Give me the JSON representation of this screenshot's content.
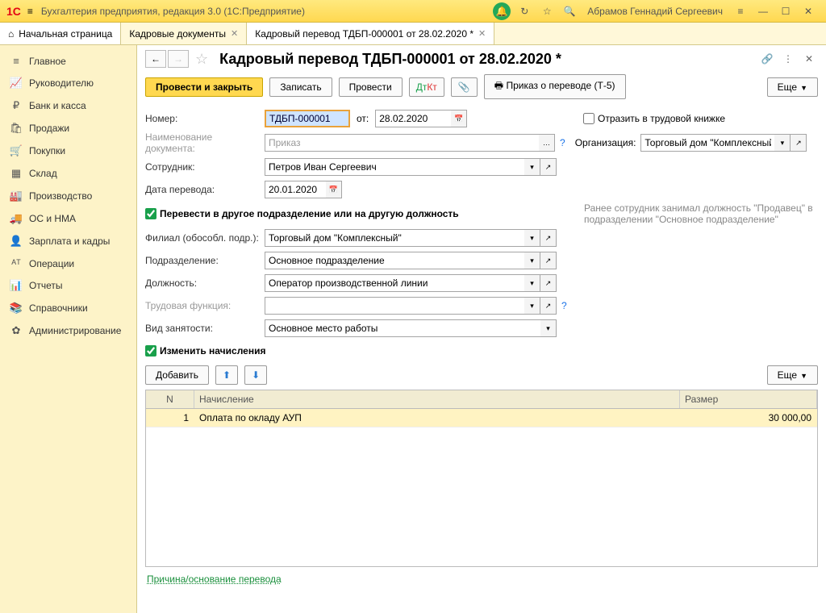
{
  "titlebar": {
    "app_title": "Бухгалтерия предприятия, редакция 3.0  (1С:Предприятие)",
    "user": "Абрамов Геннадий Сергеевич"
  },
  "tabs": {
    "home": "Начальная страница",
    "t1": "Кадровые документы",
    "t2": "Кадровый перевод ТДБП-000001 от 28.02.2020 *"
  },
  "sidebar": [
    {
      "icon": "≡",
      "label": "Главное"
    },
    {
      "icon": "📈",
      "label": "Руководителю"
    },
    {
      "icon": "₽",
      "label": "Банк и касса"
    },
    {
      "icon": "🛍",
      "label": "Продажи"
    },
    {
      "icon": "🛒",
      "label": "Покупки"
    },
    {
      "icon": "▦",
      "label": "Склад"
    },
    {
      "icon": "🏭",
      "label": "Производство"
    },
    {
      "icon": "🚚",
      "label": "ОС и НМА"
    },
    {
      "icon": "👤",
      "label": "Зарплата и кадры"
    },
    {
      "icon": "ᴬᵀ",
      "label": "Операции"
    },
    {
      "icon": "📊",
      "label": "Отчеты"
    },
    {
      "icon": "📚",
      "label": "Справочники"
    },
    {
      "icon": "✿",
      "label": "Администрирование"
    }
  ],
  "doc": {
    "title": "Кадровый перевод ТДБП-000001 от 28.02.2020 *",
    "cmds": {
      "post_close": "Провести и закрыть",
      "save": "Записать",
      "post": "Провести",
      "order": "Приказ о переводе (Т-5)",
      "more": "Еще"
    },
    "labels": {
      "number": "Номер:",
      "from": "от:",
      "reflect": "Отразить в трудовой книжке",
      "docname": "Наименование документа:",
      "org": "Организация:",
      "employee": "Сотрудник:",
      "transfer_date": "Дата перевода:",
      "do_transfer": "Перевести в другое подразделение или на другую должность",
      "branch": "Филиал (обособл. подр.):",
      "dept": "Подразделение:",
      "position": "Должность:",
      "labor_func": "Трудовая функция:",
      "emp_type": "Вид занятости:",
      "do_change": "Изменить начисления",
      "add": "Добавить",
      "prev_note": "Ранее сотрудник занимал должность \"Продавец\" в подразделении \"Основное подразделение\"",
      "footer": "Причина/основание перевода"
    },
    "values": {
      "number": "ТДБП-000001",
      "date": "28.02.2020",
      "docname": "Приказ",
      "org": "Торговый дом \"Комплексный\"",
      "employee": "Петров Иван Сергеевич",
      "transfer_date": "20.01.2020",
      "branch": "Торговый дом \"Комплексный\"",
      "dept": "Основное подразделение",
      "position": "Оператор производственной линии",
      "labor_func": "",
      "emp_type": "Основное место работы"
    },
    "table": {
      "cols": {
        "n": "N",
        "accrual": "Начисление",
        "amount": "Размер"
      },
      "rows": [
        {
          "n": "1",
          "accrual": "Оплата по окладу АУП",
          "amount": "30 000,00"
        }
      ]
    }
  }
}
